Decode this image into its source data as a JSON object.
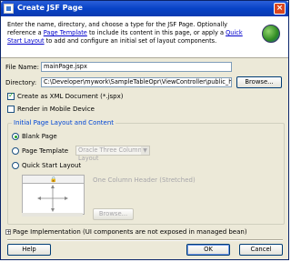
{
  "window": {
    "title": "Create JSF Page",
    "close_glyph": "×"
  },
  "header": {
    "text_before_link1": "Enter the name, directory, and choose a type for the JSF Page. Optionally reference a ",
    "link1": "Page Template",
    "text_between": " to include its content in this page, or apply a ",
    "link2": "Quick Start Layout",
    "text_after": " to add and configure an initial set of layout components."
  },
  "form": {
    "file_name_label": "File Name:",
    "file_name_value": "mainPage.jspx",
    "directory_label": "Directory:",
    "directory_value": "C:\\Developer\\mywork\\SampleTableOpr\\ViewController\\public_html",
    "browse_label": "Browse...",
    "create_xml_label": "Create as XML Document (*.jspx)",
    "create_xml_checked": true,
    "mobile_label": "Render in Mobile Device",
    "mobile_checked": false
  },
  "layout_group": {
    "title": "Initial Page Layout and Content",
    "blank_page": "Blank Page",
    "page_template": "Page Template",
    "page_template_value": "Oracle Three Column Layout",
    "quick_start": "Quick Start Layout",
    "layout_name": "One Column Header (Stretched)",
    "browse_label": "Browse..."
  },
  "implementation_label": "Page Implementation (UI components are not exposed in managed bean)",
  "buttons": {
    "help": "Help",
    "ok": "OK",
    "cancel": "Cancel"
  }
}
